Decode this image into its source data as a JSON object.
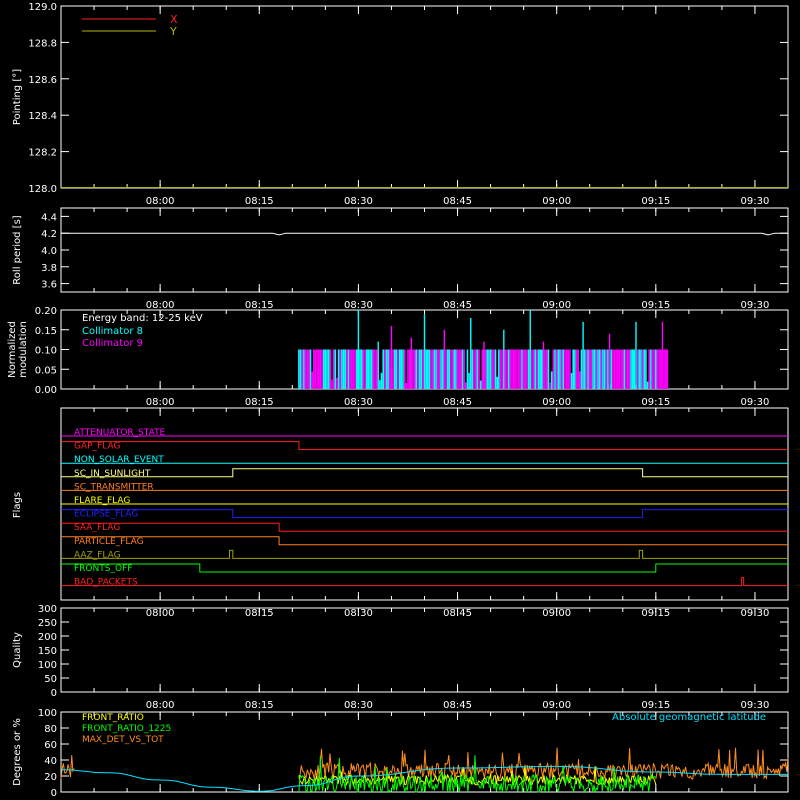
{
  "time_axis": {
    "range": [
      "07:45",
      "09:35"
    ],
    "ticks": [
      "08:00",
      "08:15",
      "08:30",
      "08:45",
      "09:00",
      "09:15",
      "09:30"
    ]
  },
  "chart_data": [
    {
      "id": "pointing",
      "type": "line",
      "title": "",
      "ylabel": "Pointing [°]",
      "ylim": [
        128.0,
        129.0
      ],
      "yticks": [
        "128.0",
        "128.2",
        "128.4",
        "128.6",
        "128.8",
        "129.0"
      ],
      "legend": "top-left",
      "series": [
        {
          "name": "X",
          "color": "#ff2020",
          "x": [
            "07:45",
            "09:35"
          ],
          "values": [
            128.0,
            128.0
          ]
        },
        {
          "name": "Y",
          "color": "#b4b400",
          "x": [
            "07:45",
            "09:35"
          ],
          "values": [
            128.0,
            128.0
          ]
        }
      ]
    },
    {
      "id": "roll",
      "type": "line",
      "title": "",
      "ylabel": "Roll period [s]",
      "ylim": [
        3.5,
        4.5
      ],
      "yticks": [
        "3.6",
        "3.8",
        "4.0",
        "4.2",
        "4.4"
      ],
      "series": [
        {
          "color": "#ffffff",
          "x": [
            "07:45",
            "08:17",
            "08:18",
            "08:19",
            "09:31",
            "09:32",
            "09:33",
            "09:35"
          ],
          "values": [
            4.2,
            4.2,
            4.18,
            4.2,
            4.2,
            4.18,
            4.2,
            4.2
          ]
        }
      ]
    },
    {
      "id": "modulation",
      "type": "bar",
      "title": "",
      "ylabel": "Normalized modulation",
      "ylim": [
        0.0,
        0.2
      ],
      "yticks": [
        "0.00",
        "0.05",
        "0.10",
        "0.15",
        "0.20"
      ],
      "annotation": "Energy band: 12-25 keV",
      "legend": "top-left",
      "active_range": [
        "08:21",
        "09:17"
      ],
      "series": [
        {
          "name": "Collimator 8",
          "color": "#00ffff",
          "base": 0.1,
          "spikes": [
            {
              "t": "08:30",
              "v": 0.2
            },
            {
              "t": "08:33",
              "v": 0.12
            },
            {
              "t": "08:40",
              "v": 0.19
            },
            {
              "t": "08:47",
              "v": 0.18
            },
            {
              "t": "08:52",
              "v": 0.15
            },
            {
              "t": "08:56",
              "v": 0.2
            },
            {
              "t": "09:04",
              "v": 0.17
            },
            {
              "t": "09:12",
              "v": 0.17
            }
          ]
        },
        {
          "name": "Collimator 9",
          "color": "#ff00ff",
          "base": 0.1,
          "spikes": [
            {
              "t": "08:35",
              "v": 0.16
            },
            {
              "t": "08:38",
              "v": 0.13
            },
            {
              "t": "08:43",
              "v": 0.15
            },
            {
              "t": "08:49",
              "v": 0.12
            },
            {
              "t": "08:58",
              "v": 0.12
            },
            {
              "t": "09:08",
              "v": 0.14
            },
            {
              "t": "09:16",
              "v": 0.17
            }
          ]
        }
      ]
    },
    {
      "id": "flags",
      "type": "line",
      "title": "",
      "ylabel": "Flags",
      "series": [
        {
          "name": "ATTENUATOR_STATE",
          "color": "#ff00ff",
          "x": [
            "07:45",
            "09:35"
          ],
          "values": [
            0,
            0
          ]
        },
        {
          "name": "GAP_FLAG",
          "color": "#ff2020",
          "x": [
            "07:45",
            "08:21",
            "08:21",
            "09:35"
          ],
          "values": [
            1,
            1,
            0,
            0
          ]
        },
        {
          "name": "NON_SOLAR_EVENT",
          "color": "#00ffff",
          "x": [
            "07:45",
            "09:35"
          ],
          "values": [
            0,
            0
          ]
        },
        {
          "name": "SC_IN_SUNLIGHT",
          "color": "#ffff80",
          "x": [
            "07:45",
            "08:11",
            "08:11",
            "09:13",
            "09:13",
            "09:35"
          ],
          "values": [
            0,
            0,
            1,
            1,
            0,
            0
          ]
        },
        {
          "name": "SC_TRANSMITTER",
          "color": "#ff7f20",
          "x": [
            "07:45",
            "09:35"
          ],
          "values": [
            0,
            0
          ]
        },
        {
          "name": "FLARE_FLAG",
          "color": "#ffff00",
          "x": [
            "07:45",
            "09:35"
          ],
          "values": [
            0,
            0
          ]
        },
        {
          "name": "ECLIPSE_FLAG",
          "color": "#2020ff",
          "x": [
            "07:45",
            "08:11",
            "08:11",
            "09:13",
            "09:13",
            "09:35"
          ],
          "values": [
            1,
            1,
            0,
            0,
            1,
            1
          ]
        },
        {
          "name": "SAA_FLAG",
          "color": "#ff2020",
          "x": [
            "07:45",
            "08:18",
            "08:18",
            "09:35"
          ],
          "values": [
            1,
            1,
            0,
            0
          ]
        },
        {
          "name": "PARTICLE_FLAG",
          "color": "#ff7f20",
          "x": [
            "07:45",
            "08:18",
            "08:18",
            "09:35"
          ],
          "values": [
            1,
            1,
            0,
            0
          ]
        },
        {
          "name": "AAZ_FLAG",
          "color": "#a0a000",
          "x": [
            "07:45",
            "08:10.5",
            "08:10.5",
            "08:11",
            "08:11",
            "09:12.5",
            "09:12.5",
            "09:13",
            "09:13",
            "09:35"
          ],
          "values": [
            0,
            0,
            1,
            1,
            0,
            0,
            1,
            1,
            0,
            0
          ]
        },
        {
          "name": "FRONTS_OFF",
          "color": "#00ff00",
          "x": [
            "07:45",
            "08:06",
            "08:06",
            "09:15",
            "09:15",
            "09:35"
          ],
          "values": [
            1,
            1,
            0,
            0,
            1,
            1
          ]
        },
        {
          "name": "BAD_PACKETS",
          "color": "#ff2020",
          "x": [
            "07:45",
            "09:28",
            "09:28",
            "09:28.3",
            "09:28.3",
            "09:35"
          ],
          "values": [
            0,
            0,
            1,
            1,
            0,
            0
          ]
        }
      ]
    },
    {
      "id": "quality",
      "type": "line",
      "title": "",
      "ylabel": "Quality",
      "ylim": [
        0,
        300
      ],
      "yticks": [
        "0",
        "50",
        "100",
        "150",
        "200",
        "250",
        "300"
      ],
      "series": []
    },
    {
      "id": "ratios",
      "type": "line",
      "title": "",
      "ylabel": "Degrees or %",
      "ylim": [
        0,
        100
      ],
      "yticks": [
        "0",
        "20",
        "40",
        "60",
        "80",
        "100"
      ],
      "annotation": "Absolute geomagnetic latitude",
      "legend": "top-left",
      "active_range": [
        "08:21",
        "09:15"
      ],
      "series": [
        {
          "name": "FRONT_RATIO",
          "color": "#ffff00",
          "level": 15,
          "spread": 6
        },
        {
          "name": "FRONT_RATIO_1225",
          "color": "#00ff00",
          "level": 10,
          "spread": 12
        },
        {
          "name": "MAX_DET_VS_TOT",
          "color": "#ff8c1a",
          "level": 26,
          "spread": 10,
          "extra_ranges": [
            [
              "07:45",
              "07:47"
            ],
            [
              "09:15",
              "09:35"
            ]
          ]
        },
        {
          "name": "Absolute geomagnetic latitude",
          "color": "#00e0ff",
          "x": [
            "07:45",
            "07:52",
            "08:00",
            "08:08",
            "08:15",
            "08:22",
            "08:30",
            "08:45",
            "09:00",
            "09:15",
            "09:25",
            "09:35"
          ],
          "values": [
            28,
            24,
            15,
            6,
            1,
            8,
            20,
            30,
            32,
            25,
            22,
            22
          ]
        }
      ]
    }
  ]
}
